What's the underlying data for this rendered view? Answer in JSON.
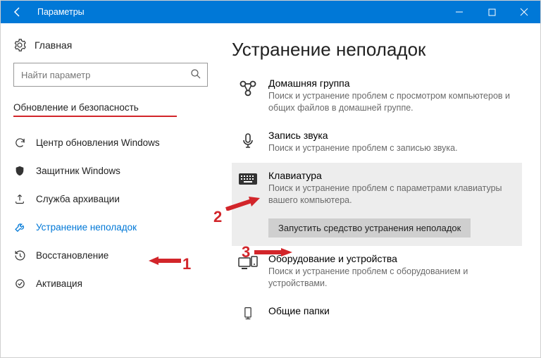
{
  "titlebar": {
    "title": "Параметры"
  },
  "sidebar": {
    "home": "Главная",
    "search_placeholder": "Найти параметр",
    "section": "Обновление и безопасность",
    "items": [
      {
        "label": "Центр обновления Windows"
      },
      {
        "label": "Защитник Windows"
      },
      {
        "label": "Служба архивации"
      },
      {
        "label": "Устранение неполадок"
      },
      {
        "label": "Восстановление"
      },
      {
        "label": "Активация"
      }
    ]
  },
  "main": {
    "heading": "Устранение неполадок",
    "tiles": [
      {
        "title": "Домашняя группа",
        "desc": "Поиск и устранение проблем с просмотром компьютеров и общих файлов в домашней группе."
      },
      {
        "title": "Запись звука",
        "desc": "Поиск и устранение проблем с записью звука."
      },
      {
        "title": "Клавиатура",
        "desc": "Поиск и устранение проблем с параметрами клавиатуры вашего компьютера."
      },
      {
        "title": "Оборудование и устройства",
        "desc": "Поиск и устранение проблем с оборудованием и устройствами."
      },
      {
        "title": "Общие папки",
        "desc": ""
      }
    ],
    "run_button": "Запустить средство устранения неполадок"
  },
  "annotations": {
    "n1": "1",
    "n2": "2",
    "n3": "3"
  }
}
